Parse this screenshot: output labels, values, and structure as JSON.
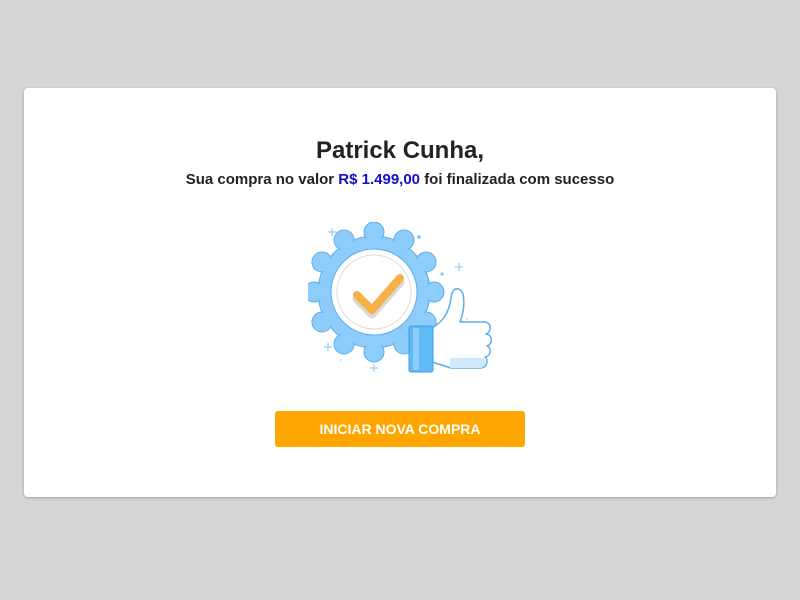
{
  "confirmation": {
    "customer_name": "Patrick Cunha,",
    "message_prefix": "Sua compra no valor",
    "amount": "R$ 1.499,00",
    "message_suffix": "foi finalizada com sucesso",
    "illustration_icon": "badge-check-thumbs-up-icon",
    "button_label": "INICIAR NOVA COMPRA"
  },
  "colors": {
    "background": "#d6d6d6",
    "card": "#ffffff",
    "amount_text": "#1010c8",
    "button": "#ffa500",
    "badge_blue": "#8ecdfb",
    "check_orange": "#f7b045"
  }
}
